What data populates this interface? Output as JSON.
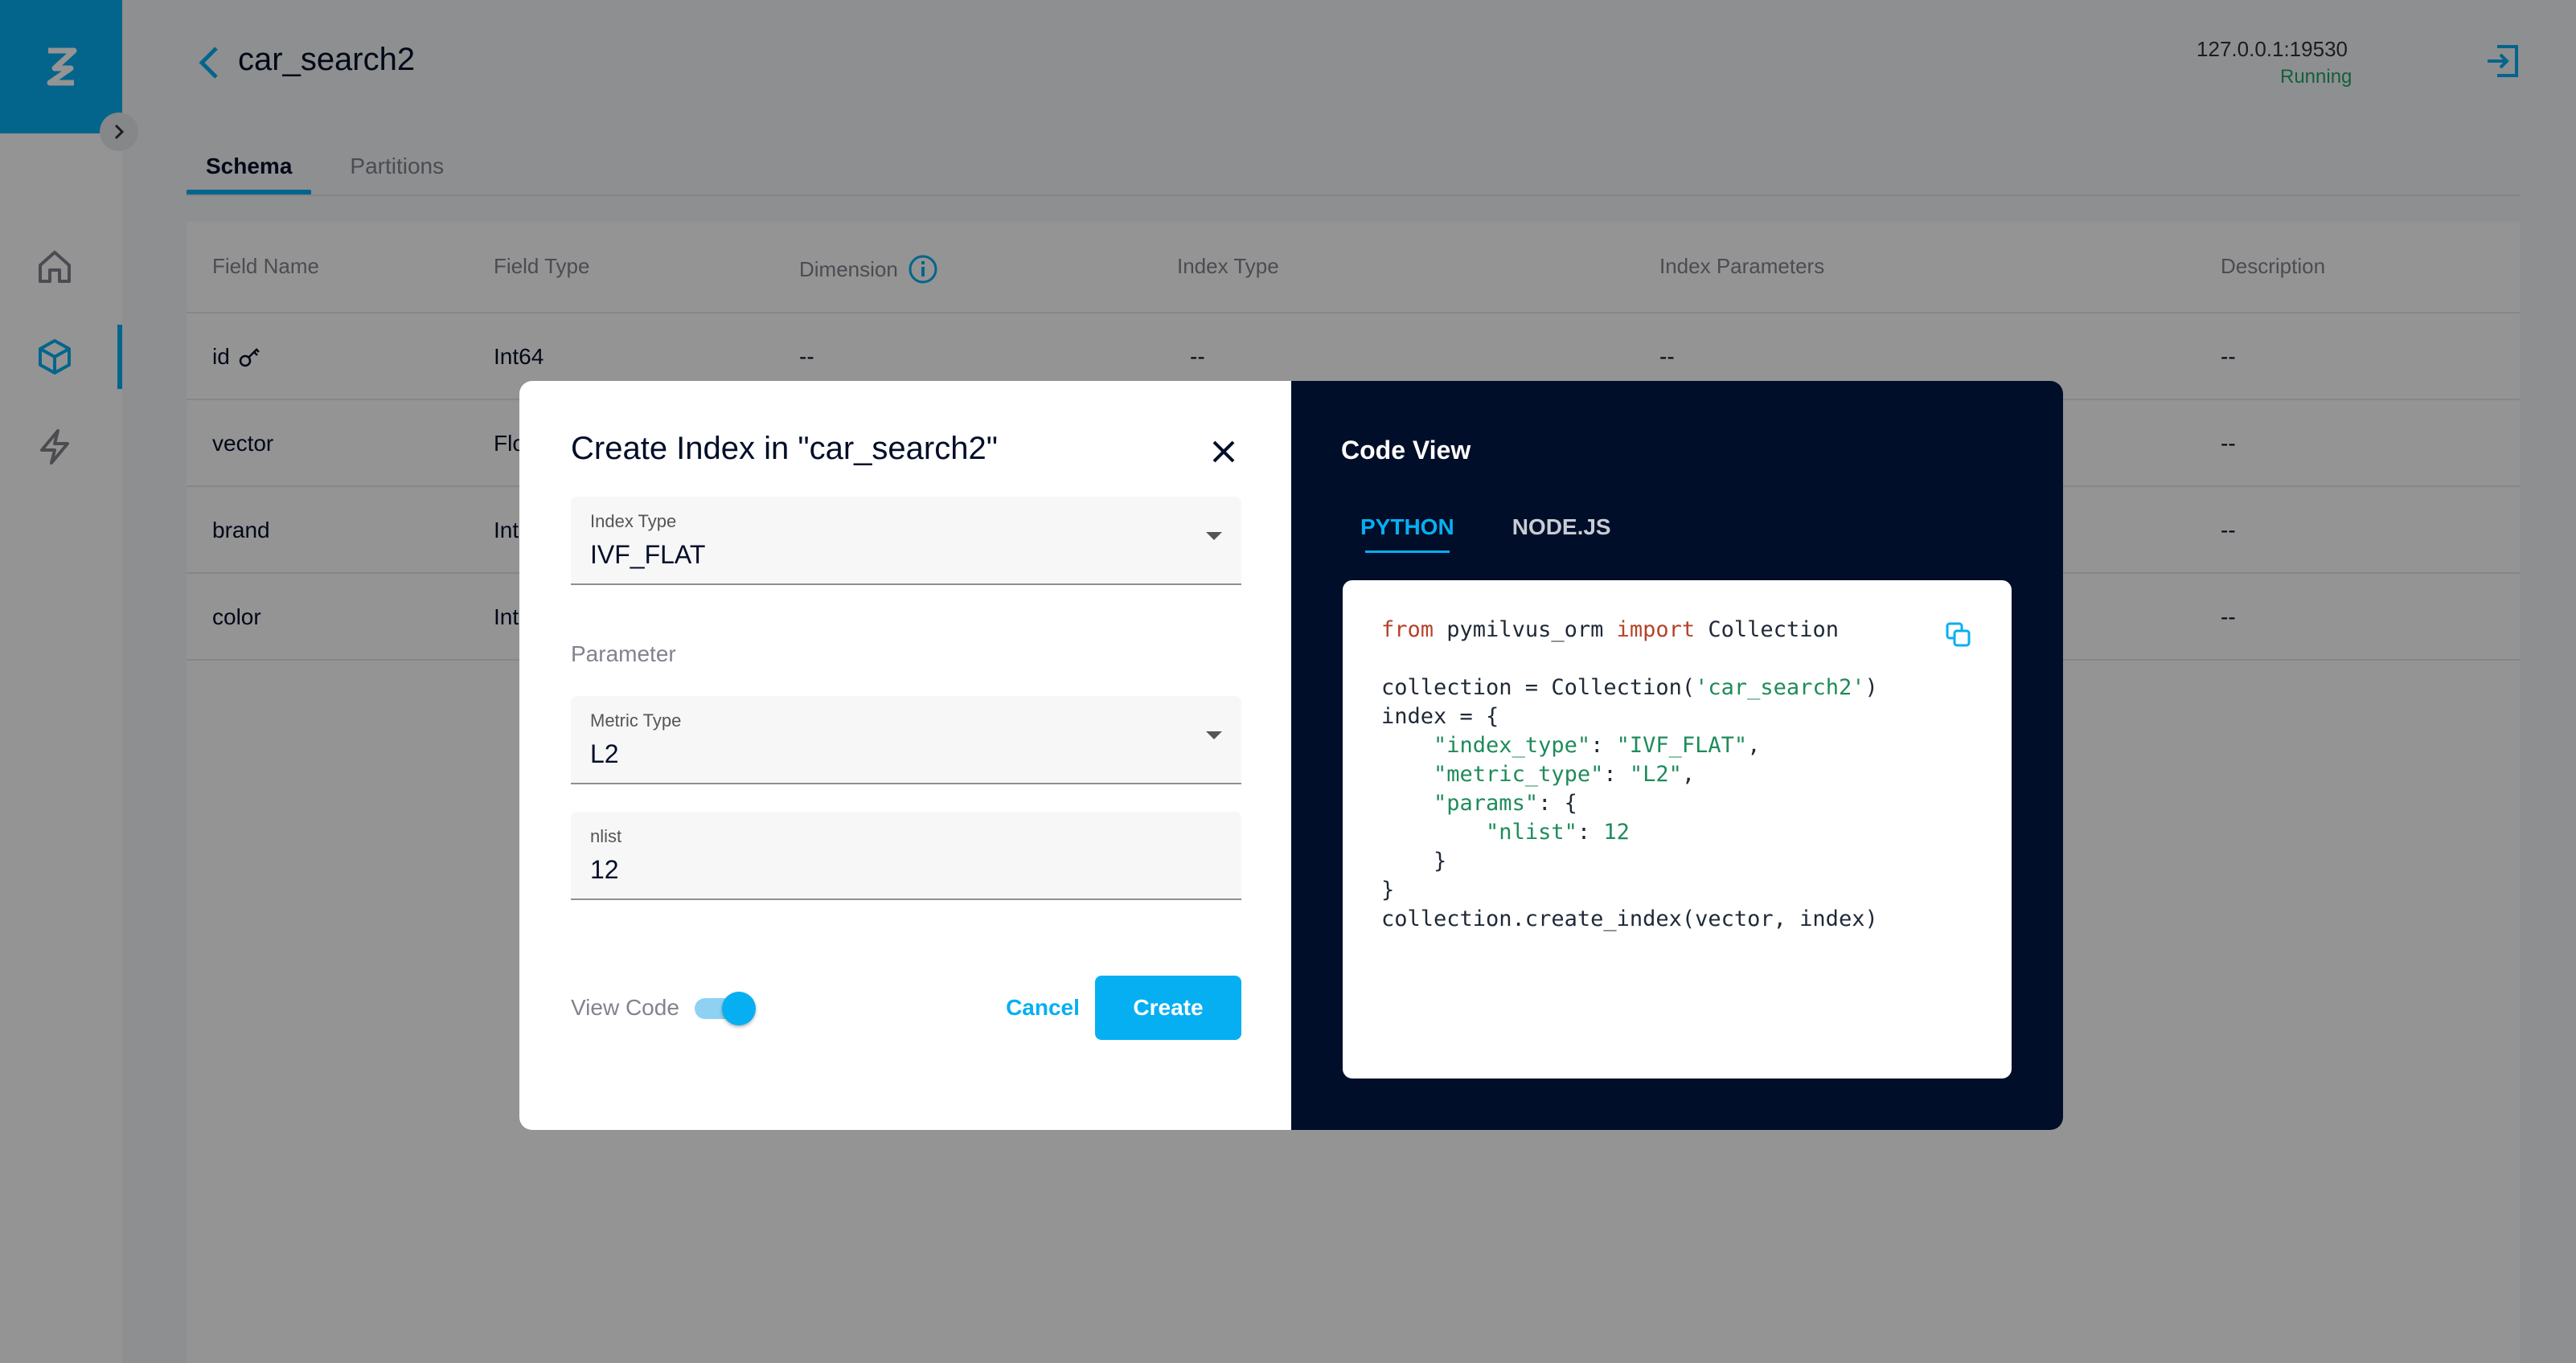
{
  "colors": {
    "accent": "#06aff2",
    "status_running": "#20a66b",
    "code_bg": "#010e29"
  },
  "header": {
    "title": "car_search2",
    "server_address": "127.0.0.1:19530",
    "server_status": "Running"
  },
  "tabs": [
    {
      "label": "Schema",
      "active": true
    },
    {
      "label": "Partitions",
      "active": false
    }
  ],
  "table": {
    "headers": [
      "Field Name",
      "Field Type",
      "Dimension",
      "Index Type",
      "Index Parameters",
      "Description"
    ],
    "rows": [
      {
        "name": "id",
        "type": "Int64",
        "dimension": "--",
        "index_type": "--",
        "index_params": "--",
        "description": "--"
      },
      {
        "name": "vector",
        "type": "Flo",
        "dimension": "",
        "index_type": "",
        "index_params": "",
        "description": "--"
      },
      {
        "name": "brand",
        "type": "Int",
        "dimension": "",
        "index_type": "",
        "index_params": "",
        "description": "--"
      },
      {
        "name": "color",
        "type": "Int",
        "dimension": "",
        "index_type": "",
        "index_params": "",
        "description": "--"
      }
    ]
  },
  "dialog": {
    "title": "Create Index in \"car_search2\"",
    "index_type": {
      "label": "Index Type",
      "value": "IVF_FLAT"
    },
    "parameter_label": "Parameter",
    "metric_type": {
      "label": "Metric Type",
      "value": "L2"
    },
    "nlist": {
      "label": "nlist",
      "value": "12"
    },
    "view_code_label": "View Code",
    "view_code_on": true,
    "cancel_label": "Cancel",
    "create_label": "Create"
  },
  "code_view": {
    "title": "Code View",
    "tabs": [
      {
        "label": "PYTHON",
        "active": true
      },
      {
        "label": "NODE.JS",
        "active": false
      }
    ],
    "code": {
      "l1_from": "from",
      "l1_module": " pymilvus_orm ",
      "l1_import": "import",
      "l1_name": " Collection",
      "l2_a": "collection = Collection(",
      "l2_str": "'car_search2'",
      "l2_b": ")",
      "l3": "index = {",
      "l4_key": "\"index_type\"",
      "l4_val": "\"IVF_FLAT\"",
      "l5_key": "\"metric_type\"",
      "l5_val": "\"L2\"",
      "l6_key": "\"params\"",
      "l7_key": "\"nlist\"",
      "l7_val": "12",
      "l10": "collection.create_index(vector, index)"
    }
  }
}
